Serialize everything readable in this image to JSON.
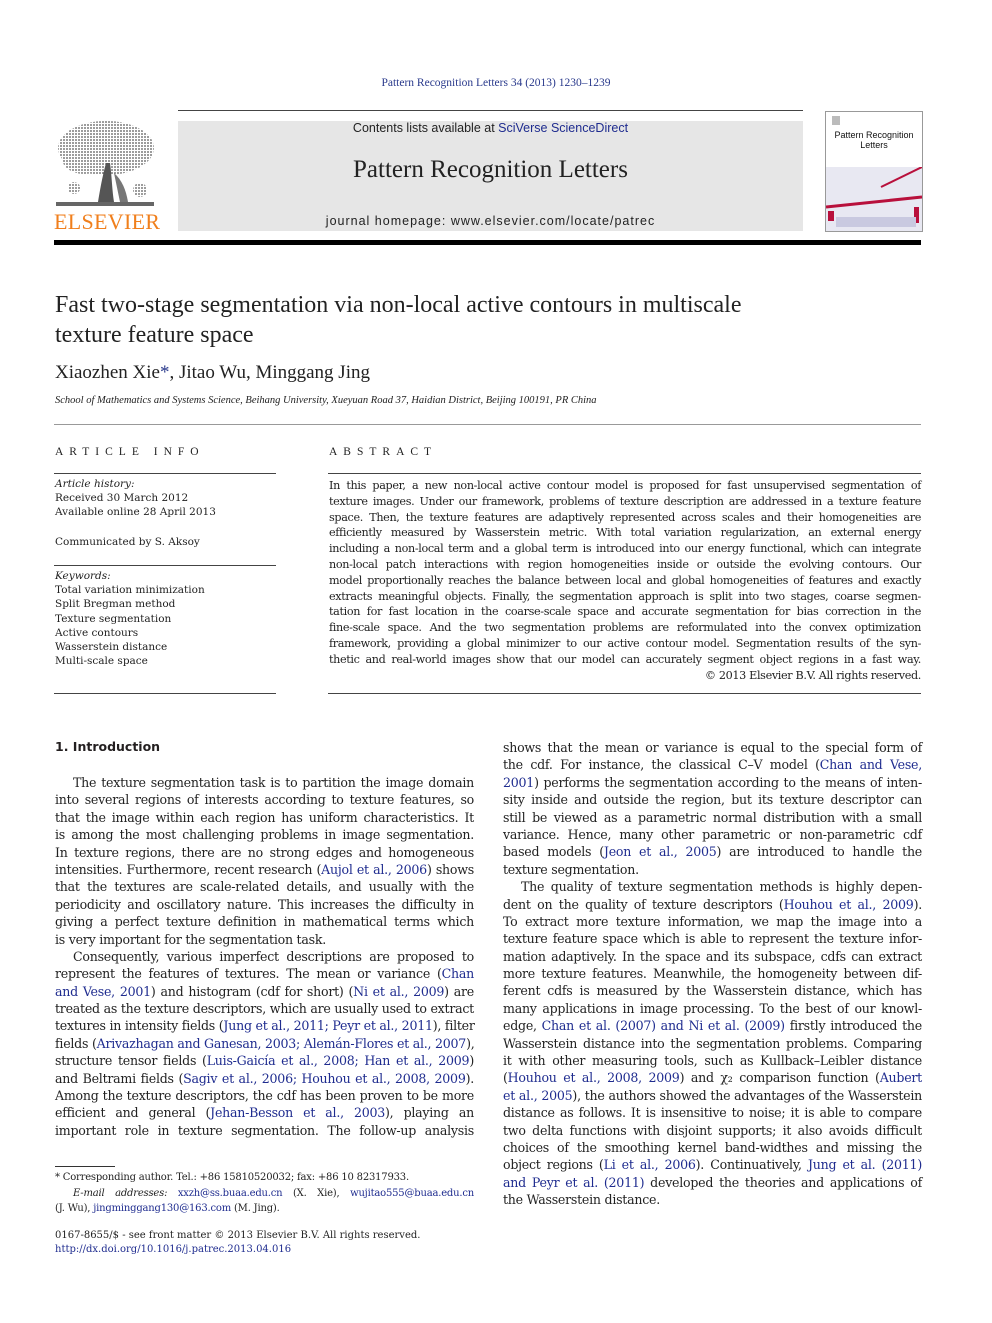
{
  "header": {
    "running_head": "Pattern Recognition Letters 34 (2013) 1230–1239",
    "contents_prefix": "Contents lists available at ",
    "contents_link": "SciVerse ScienceDirect",
    "journal_name": "Pattern Recognition Letters",
    "homepage": "journal homepage: www.elsevier.com/locate/patrec",
    "publisher_wordmark": "ELSEVIER",
    "cover_title_line1": "Pattern Recognition",
    "cover_title_line2": "Letters",
    "colors": {
      "brand_orange": "#f07f1c",
      "link_blue": "#1f2c8f",
      "banner_gray": "#e6e6e6"
    }
  },
  "article": {
    "title_line1": "Fast two-stage segmentation via non-local active contours in multiscale",
    "title_line2": "texture feature space",
    "authors": [
      {
        "name": "Xiaozhen Xie",
        "mark": "*"
      },
      {
        "name": "Jitao Wu",
        "mark": ""
      },
      {
        "name": "Minggang Jing",
        "mark": ""
      }
    ],
    "affiliation": "School of Mathematics and Systems Science, Beihang University, Xueyuan Road 37, Haidian District, Beijing 100191, PR China"
  },
  "article_info": {
    "heading": "ARTICLE INFO",
    "history_label": "Article history:",
    "received": "Received 30 March 2012",
    "available": "Available online 28 April 2013",
    "communicated": "Communicated by S. Aksoy",
    "keywords_label": "Keywords:",
    "keywords": [
      "Total variation minimization",
      "Split Bregman method",
      "Texture segmentation",
      "Active contours",
      "Wasserstein distance",
      "Multi-scale space"
    ]
  },
  "abstract": {
    "heading": "ABSTRACT",
    "lines": [
      "In this paper, a new non-local active contour model is proposed for fast unsupervised segmentation of",
      "texture images. Under our framework, problems of texture description are addressed in a texture feature",
      "space. Then, the texture features are adaptively represented across scales and their homogeneities are",
      "efficiently measured by Wasserstein metric. With total variation regularization, an external energy",
      "including a non-local term and a global term is introduced into our energy functional, which can integrate",
      "non-local patch interactions with region homogeneities inside or outside the evolving contours. Our",
      "model proportionally reaches the balance between local and global homogeneities of features and exactly",
      "extracts meaningful objects. Finally, the segmentation approach is split into two stages, coarse segmen-",
      "tation for fast location in the coarse-scale space and accurate segmentation for bias correction in the",
      "fine-scale space. And the two segmentation problems are reformulated into the convex optimization",
      "framework, providing a global minimizer to our active contour model. Segmentation results of the syn-",
      "thetic and real-world images show that our model can accurately segment object regions in a fast way."
    ],
    "copyright": "© 2013 Elsevier B.V. All rights reserved."
  },
  "body": {
    "section_heading": "1. Introduction",
    "left_lines": [
      {
        "segs": [
          {
            "t": "The texture segmentation task is to partition the image domain"
          }
        ],
        "indent": true
      },
      {
        "segs": [
          {
            "t": "into several regions of interests according to texture features, so"
          }
        ]
      },
      {
        "segs": [
          {
            "t": "that the image within each region has uniform characteristics. It"
          }
        ]
      },
      {
        "segs": [
          {
            "t": "is among the most challenging problems in image segmentation."
          }
        ]
      },
      {
        "segs": [
          {
            "t": "In texture regions, there are no strong edges and homogeneous"
          }
        ]
      },
      {
        "segs": [
          {
            "t": "intensities. Furthermore, recent research ("
          },
          {
            "t": "Aujol et al., 2006",
            "link": true
          },
          {
            "t": ") shows"
          }
        ]
      },
      {
        "segs": [
          {
            "t": "that the textures are scale-related details, and usually with the"
          }
        ]
      },
      {
        "segs": [
          {
            "t": "periodicity and oscillatory nature. This increases the difficulty in"
          }
        ]
      },
      {
        "segs": [
          {
            "t": "giving a perfect texture definition in mathematical terms which"
          }
        ]
      },
      {
        "segs": [
          {
            "t": "is very important for the segmentation task."
          }
        ],
        "last": true
      },
      {
        "segs": [
          {
            "t": "Consequently, various imperfect descriptions are proposed to"
          }
        ],
        "indent": true
      },
      {
        "segs": [
          {
            "t": "represent the features of textures. The mean or variance ("
          },
          {
            "t": "Chan",
            "link": true
          }
        ]
      },
      {
        "segs": [
          {
            "t": "and Vese, 2001",
            "link": true
          },
          {
            "t": ") and histogram (cdf for short) ("
          },
          {
            "t": "Ni et al., 2009",
            "link": true
          },
          {
            "t": ") are"
          }
        ]
      },
      {
        "segs": [
          {
            "t": "treated as the texture descriptors, which are usually used to extract"
          }
        ]
      },
      {
        "segs": [
          {
            "t": "textures in intensity fields ("
          },
          {
            "t": "Jung et al., 2011; Peyr et al., 2011",
            "link": true
          },
          {
            "t": "), filter"
          }
        ]
      },
      {
        "segs": [
          {
            "t": "fields ("
          },
          {
            "t": "Arivazhagan and Ganesan, 2003; Alemán-Flores et al., 2007",
            "link": true
          },
          {
            "t": "),"
          }
        ]
      },
      {
        "segs": [
          {
            "t": "structure tensor fields ("
          },
          {
            "t": "Luis-Gaicía et al., 2008; Han et al., 2009",
            "link": true
          },
          {
            "t": ")"
          }
        ]
      },
      {
        "segs": [
          {
            "t": "and Beltrami fields ("
          },
          {
            "t": "Sagiv et al., 2006; Houhou et al., 2008, 2009",
            "link": true
          },
          {
            "t": ")."
          }
        ]
      },
      {
        "segs": [
          {
            "t": "Among the texture descriptors, the cdf has been proven to be more"
          }
        ]
      },
      {
        "segs": [
          {
            "t": "efficient and general ("
          },
          {
            "t": "Jehan-Besson et al., 2003",
            "link": true
          },
          {
            "t": "), playing an"
          }
        ]
      },
      {
        "segs": [
          {
            "t": "important role in texture segmentation. The follow-up analysis"
          }
        ]
      }
    ],
    "right_lines": [
      {
        "segs": [
          {
            "t": "shows that the mean or variance is equal to the special form of"
          }
        ]
      },
      {
        "segs": [
          {
            "t": "the cdf. For instance, the classical C–V model ("
          },
          {
            "t": "Chan and Vese,",
            "link": true
          }
        ]
      },
      {
        "segs": [
          {
            "t": "2001",
            "link": true
          },
          {
            "t": ") performs the segmentation according to the means of inten-"
          }
        ]
      },
      {
        "segs": [
          {
            "t": "sity inside and outside the region, but its texture descriptor can"
          }
        ]
      },
      {
        "segs": [
          {
            "t": "still be viewed as a parametric normal distribution with a small"
          }
        ]
      },
      {
        "segs": [
          {
            "t": "variance. Hence, many other parametric or non-parametric cdf"
          }
        ]
      },
      {
        "segs": [
          {
            "t": "based models ("
          },
          {
            "t": "Jeon et al., 2005",
            "link": true
          },
          {
            "t": ") are introduced to handle the"
          }
        ]
      },
      {
        "segs": [
          {
            "t": "texture segmentation."
          }
        ],
        "last": true
      },
      {
        "segs": [
          {
            "t": "The quality of texture segmentation methods is highly depen-"
          }
        ],
        "indent": true
      },
      {
        "segs": [
          {
            "t": "dent on the quality of texture descriptors ("
          },
          {
            "t": "Houhou et al., 2009",
            "link": true
          },
          {
            "t": ")."
          }
        ]
      },
      {
        "segs": [
          {
            "t": "To extract more texture information, we map the image into a"
          }
        ]
      },
      {
        "segs": [
          {
            "t": "texture feature space which is able to represent the texture infor-"
          }
        ]
      },
      {
        "segs": [
          {
            "t": "mation adaptively. In the space and its subspace, cdfs can extract"
          }
        ]
      },
      {
        "segs": [
          {
            "t": "more texture features. Meanwhile, the homogeneity between dif-"
          }
        ]
      },
      {
        "segs": [
          {
            "t": "ferent cdfs is measured by the Wasserstein distance, which has"
          }
        ]
      },
      {
        "segs": [
          {
            "t": "many applications in image processing. To the best of our knowl-"
          }
        ]
      },
      {
        "segs": [
          {
            "t": "edge, "
          },
          {
            "t": "Chan et al. (2007) and Ni et al. (2009)",
            "link": true
          },
          {
            "t": " firstly introduced the"
          }
        ]
      },
      {
        "segs": [
          {
            "t": "Wasserstein distance into the segmentation problems. Comparing"
          }
        ]
      },
      {
        "segs": [
          {
            "t": "it with other measuring tools, such as Kullback–Leibler distance"
          }
        ]
      },
      {
        "segs": [
          {
            "t": "("
          },
          {
            "t": "Houhou et al., 2008, 2009",
            "link": true
          },
          {
            "t": ") and χ₂ comparison function ("
          },
          {
            "t": "Aubert",
            "link": true
          }
        ]
      },
      {
        "segs": [
          {
            "t": "et al., 2005",
            "link": true
          },
          {
            "t": "), the authors showed the advantages of the Wasserstein"
          }
        ]
      },
      {
        "segs": [
          {
            "t": "distance as follows. It is insensitive to noise; it is able to compare"
          }
        ]
      },
      {
        "segs": [
          {
            "t": "two delta functions with disjoint supports; it also avoids difficult"
          }
        ]
      },
      {
        "segs": [
          {
            "t": "choices of the smoothing kernel band-widthes and missing the"
          }
        ]
      },
      {
        "segs": [
          {
            "t": "object regions ("
          },
          {
            "t": "Li et al., 2006",
            "link": true
          },
          {
            "t": "). Continuatively, "
          },
          {
            "t": "Jung et al. (2011)",
            "link": true
          }
        ]
      },
      {
        "segs": [
          {
            "t": "and Peyr et al. (2011)",
            "link": true
          },
          {
            "t": " developed the theories and applications of"
          }
        ]
      },
      {
        "segs": [
          {
            "t": "the Wasserstein distance."
          }
        ],
        "last": true
      }
    ]
  },
  "footnotes": {
    "lines": [
      {
        "segs": [
          {
            "t": "  * Corresponding author. Tel.: +86 15810520032; fax: +86 10 82317933."
          }
        ],
        "last": true
      },
      {
        "segs": [
          {
            "t": "E-mail addresses: ",
            "ital": true
          },
          {
            "t": "xxzh@ss.buaa.edu.cn",
            "link": true
          },
          {
            "t": " (X. Xie), "
          },
          {
            "t": "wujitao555@buaa.edu.cn",
            "link": true
          }
        ],
        "indent": true
      },
      {
        "segs": [
          {
            "t": "(J. Wu), "
          },
          {
            "t": "jingminggang130@163.com",
            "link": true
          },
          {
            "t": " (M. Jing)."
          }
        ],
        "last": true
      }
    ],
    "front_matter": "0167-8655/$ - see front matter © 2013 Elsevier B.V. All rights reserved.",
    "doi": "http://dx.doi.org/10.1016/j.patrec.2013.04.016"
  }
}
